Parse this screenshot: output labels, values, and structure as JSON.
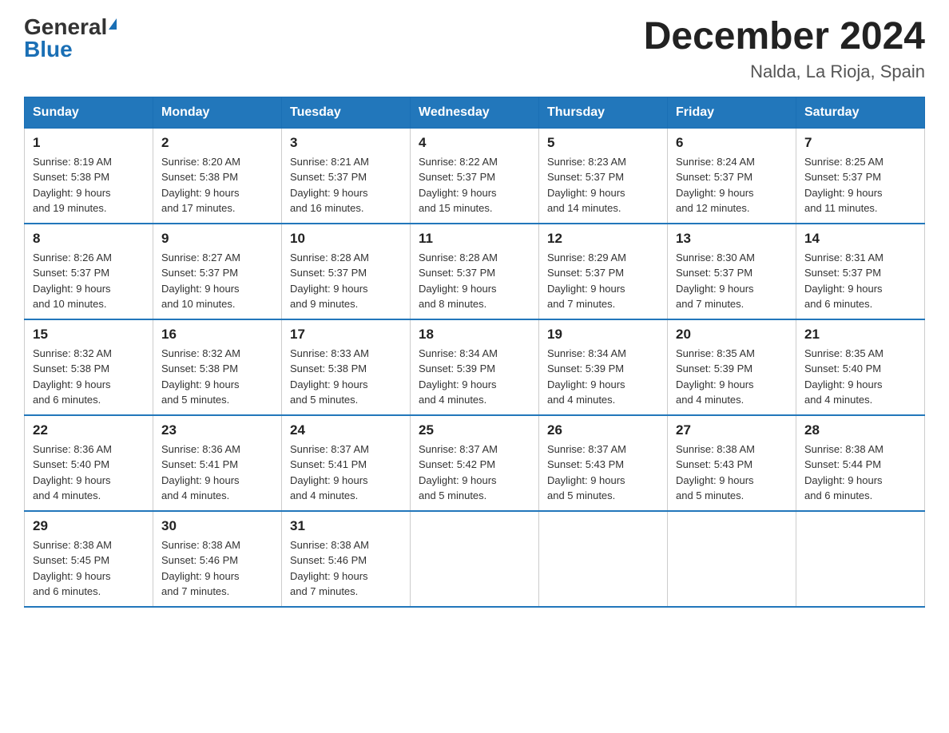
{
  "header": {
    "logo_general": "General",
    "logo_blue": "Blue",
    "month_title": "December 2024",
    "location": "Nalda, La Rioja, Spain"
  },
  "columns": [
    "Sunday",
    "Monday",
    "Tuesday",
    "Wednesday",
    "Thursday",
    "Friday",
    "Saturday"
  ],
  "weeks": [
    [
      {
        "day": "1",
        "sunrise": "8:19 AM",
        "sunset": "5:38 PM",
        "daylight": "9 hours and 19 minutes."
      },
      {
        "day": "2",
        "sunrise": "8:20 AM",
        "sunset": "5:38 PM",
        "daylight": "9 hours and 17 minutes."
      },
      {
        "day": "3",
        "sunrise": "8:21 AM",
        "sunset": "5:37 PM",
        "daylight": "9 hours and 16 minutes."
      },
      {
        "day": "4",
        "sunrise": "8:22 AM",
        "sunset": "5:37 PM",
        "daylight": "9 hours and 15 minutes."
      },
      {
        "day": "5",
        "sunrise": "8:23 AM",
        "sunset": "5:37 PM",
        "daylight": "9 hours and 14 minutes."
      },
      {
        "day": "6",
        "sunrise": "8:24 AM",
        "sunset": "5:37 PM",
        "daylight": "9 hours and 12 minutes."
      },
      {
        "day": "7",
        "sunrise": "8:25 AM",
        "sunset": "5:37 PM",
        "daylight": "9 hours and 11 minutes."
      }
    ],
    [
      {
        "day": "8",
        "sunrise": "8:26 AM",
        "sunset": "5:37 PM",
        "daylight": "9 hours and 10 minutes."
      },
      {
        "day": "9",
        "sunrise": "8:27 AM",
        "sunset": "5:37 PM",
        "daylight": "9 hours and 10 minutes."
      },
      {
        "day": "10",
        "sunrise": "8:28 AM",
        "sunset": "5:37 PM",
        "daylight": "9 hours and 9 minutes."
      },
      {
        "day": "11",
        "sunrise": "8:28 AM",
        "sunset": "5:37 PM",
        "daylight": "9 hours and 8 minutes."
      },
      {
        "day": "12",
        "sunrise": "8:29 AM",
        "sunset": "5:37 PM",
        "daylight": "9 hours and 7 minutes."
      },
      {
        "day": "13",
        "sunrise": "8:30 AM",
        "sunset": "5:37 PM",
        "daylight": "9 hours and 7 minutes."
      },
      {
        "day": "14",
        "sunrise": "8:31 AM",
        "sunset": "5:37 PM",
        "daylight": "9 hours and 6 minutes."
      }
    ],
    [
      {
        "day": "15",
        "sunrise": "8:32 AM",
        "sunset": "5:38 PM",
        "daylight": "9 hours and 6 minutes."
      },
      {
        "day": "16",
        "sunrise": "8:32 AM",
        "sunset": "5:38 PM",
        "daylight": "9 hours and 5 minutes."
      },
      {
        "day": "17",
        "sunrise": "8:33 AM",
        "sunset": "5:38 PM",
        "daylight": "9 hours and 5 minutes."
      },
      {
        "day": "18",
        "sunrise": "8:34 AM",
        "sunset": "5:39 PM",
        "daylight": "9 hours and 4 minutes."
      },
      {
        "day": "19",
        "sunrise": "8:34 AM",
        "sunset": "5:39 PM",
        "daylight": "9 hours and 4 minutes."
      },
      {
        "day": "20",
        "sunrise": "8:35 AM",
        "sunset": "5:39 PM",
        "daylight": "9 hours and 4 minutes."
      },
      {
        "day": "21",
        "sunrise": "8:35 AM",
        "sunset": "5:40 PM",
        "daylight": "9 hours and 4 minutes."
      }
    ],
    [
      {
        "day": "22",
        "sunrise": "8:36 AM",
        "sunset": "5:40 PM",
        "daylight": "9 hours and 4 minutes."
      },
      {
        "day": "23",
        "sunrise": "8:36 AM",
        "sunset": "5:41 PM",
        "daylight": "9 hours and 4 minutes."
      },
      {
        "day": "24",
        "sunrise": "8:37 AM",
        "sunset": "5:41 PM",
        "daylight": "9 hours and 4 minutes."
      },
      {
        "day": "25",
        "sunrise": "8:37 AM",
        "sunset": "5:42 PM",
        "daylight": "9 hours and 5 minutes."
      },
      {
        "day": "26",
        "sunrise": "8:37 AM",
        "sunset": "5:43 PM",
        "daylight": "9 hours and 5 minutes."
      },
      {
        "day": "27",
        "sunrise": "8:38 AM",
        "sunset": "5:43 PM",
        "daylight": "9 hours and 5 minutes."
      },
      {
        "day": "28",
        "sunrise": "8:38 AM",
        "sunset": "5:44 PM",
        "daylight": "9 hours and 6 minutes."
      }
    ],
    [
      {
        "day": "29",
        "sunrise": "8:38 AM",
        "sunset": "5:45 PM",
        "daylight": "9 hours and 6 minutes."
      },
      {
        "day": "30",
        "sunrise": "8:38 AM",
        "sunset": "5:46 PM",
        "daylight": "9 hours and 7 minutes."
      },
      {
        "day": "31",
        "sunrise": "8:38 AM",
        "sunset": "5:46 PM",
        "daylight": "9 hours and 7 minutes."
      },
      null,
      null,
      null,
      null
    ]
  ],
  "labels": {
    "sunrise": "Sunrise:",
    "sunset": "Sunset:",
    "daylight": "Daylight:"
  }
}
